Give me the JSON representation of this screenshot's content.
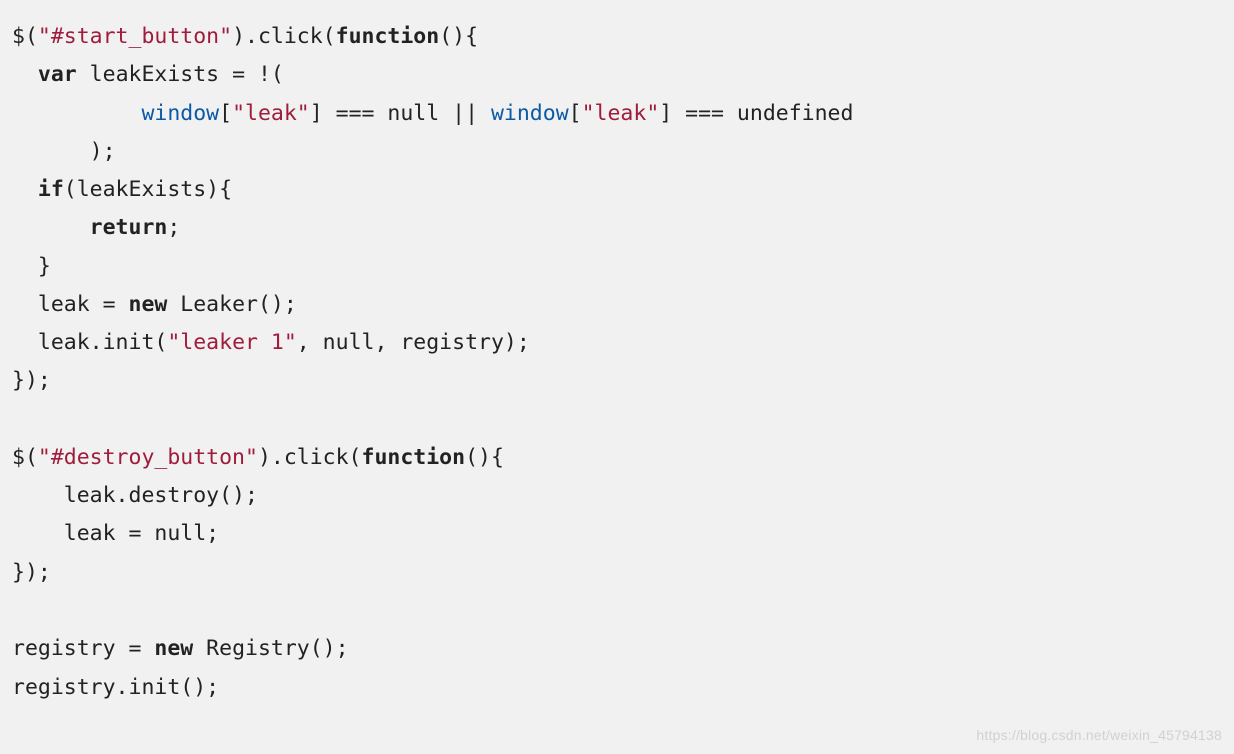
{
  "code": {
    "tokens": [
      {
        "t": "$(",
        "c": ""
      },
      {
        "t": "\"#start_button\"",
        "c": "str"
      },
      {
        "t": ").click(",
        "c": ""
      },
      {
        "t": "function",
        "c": "kw"
      },
      {
        "t": "(){",
        "c": ""
      },
      {
        "t": "\n",
        "c": ""
      },
      {
        "t": "  ",
        "c": ""
      },
      {
        "t": "var",
        "c": "kw"
      },
      {
        "t": " leakExists = !(",
        "c": ""
      },
      {
        "t": "\n",
        "c": ""
      },
      {
        "t": "          ",
        "c": ""
      },
      {
        "t": "window",
        "c": "id"
      },
      {
        "t": "[",
        "c": ""
      },
      {
        "t": "\"leak\"",
        "c": "str"
      },
      {
        "t": "] === null || ",
        "c": ""
      },
      {
        "t": "window",
        "c": "id"
      },
      {
        "t": "[",
        "c": ""
      },
      {
        "t": "\"leak\"",
        "c": "str"
      },
      {
        "t": "] === undefined",
        "c": ""
      },
      {
        "t": "\n",
        "c": ""
      },
      {
        "t": "      );",
        "c": ""
      },
      {
        "t": "\n",
        "c": ""
      },
      {
        "t": "  ",
        "c": ""
      },
      {
        "t": "if",
        "c": "kw"
      },
      {
        "t": "(leakExists){",
        "c": ""
      },
      {
        "t": "\n",
        "c": ""
      },
      {
        "t": "      ",
        "c": ""
      },
      {
        "t": "return",
        "c": "kw"
      },
      {
        "t": ";",
        "c": ""
      },
      {
        "t": "\n",
        "c": ""
      },
      {
        "t": "  }",
        "c": ""
      },
      {
        "t": "\n",
        "c": ""
      },
      {
        "t": "  leak = ",
        "c": ""
      },
      {
        "t": "new",
        "c": "kw"
      },
      {
        "t": " Leaker();",
        "c": ""
      },
      {
        "t": "\n",
        "c": ""
      },
      {
        "t": "  leak.init(",
        "c": ""
      },
      {
        "t": "\"leaker 1\"",
        "c": "str"
      },
      {
        "t": ", null, registry);",
        "c": ""
      },
      {
        "t": "\n",
        "c": ""
      },
      {
        "t": "});",
        "c": ""
      },
      {
        "t": "\n",
        "c": ""
      },
      {
        "t": "\n",
        "c": ""
      },
      {
        "t": "$(",
        "c": ""
      },
      {
        "t": "\"#destroy_button\"",
        "c": "str"
      },
      {
        "t": ").click(",
        "c": ""
      },
      {
        "t": "function",
        "c": "kw"
      },
      {
        "t": "(){",
        "c": ""
      },
      {
        "t": "\n",
        "c": ""
      },
      {
        "t": "    leak.destroy();",
        "c": ""
      },
      {
        "t": "\n",
        "c": ""
      },
      {
        "t": "    leak = null;",
        "c": ""
      },
      {
        "t": "\n",
        "c": ""
      },
      {
        "t": "});",
        "c": ""
      },
      {
        "t": "\n",
        "c": ""
      },
      {
        "t": "\n",
        "c": ""
      },
      {
        "t": "registry = ",
        "c": ""
      },
      {
        "t": "new",
        "c": "kw"
      },
      {
        "t": " Registry();",
        "c": ""
      },
      {
        "t": "\n",
        "c": ""
      },
      {
        "t": "registry.init();",
        "c": ""
      }
    ]
  },
  "watermark": "https://blog.csdn.net/weixin_45794138"
}
